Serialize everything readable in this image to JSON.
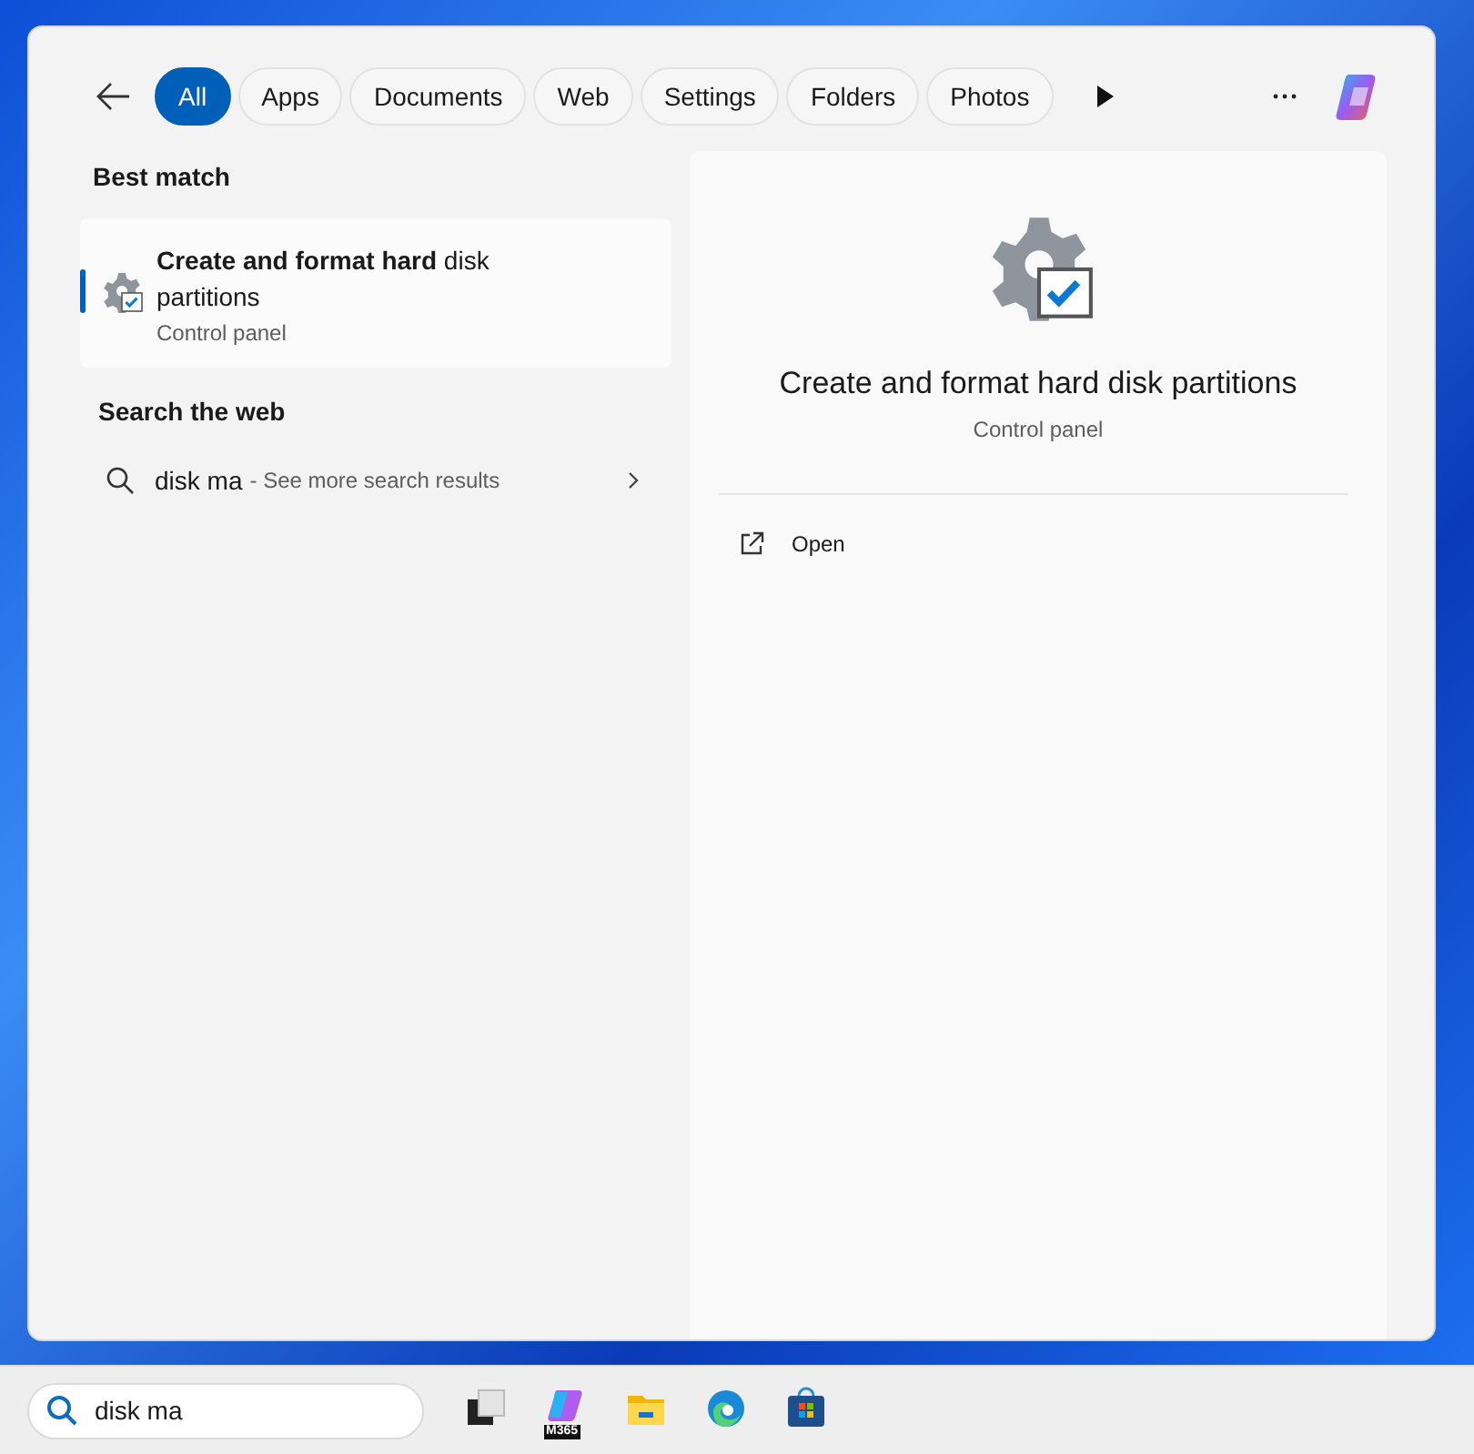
{
  "filter_tabs": [
    {
      "label": "All",
      "selected": true
    },
    {
      "label": "Apps",
      "selected": false
    },
    {
      "label": "Documents",
      "selected": false
    },
    {
      "label": "Web",
      "selected": false
    },
    {
      "label": "Settings",
      "selected": false
    },
    {
      "label": "Folders",
      "selected": false
    },
    {
      "label": "Photos",
      "selected": false
    }
  ],
  "best_match": {
    "heading": "Best match",
    "title": "**Create and format hard** disk partitions",
    "subtitle": "Control panel",
    "selected": true
  },
  "web_section": {
    "heading": "Search the web",
    "query": "disk ma",
    "hint": "- See more search results"
  },
  "preview": {
    "title": "Create and format hard disk partitions",
    "subtitle": "Control panel",
    "actions": [
      {
        "label": "Open"
      }
    ]
  },
  "taskbar": {
    "search": {
      "value": "disk ma"
    },
    "apps": [
      {
        "kind": "task-view"
      },
      {
        "kind": "m365",
        "badge": "M365"
      },
      {
        "kind": "folder"
      },
      {
        "kind": "edge"
      },
      {
        "kind": "store"
      }
    ]
  }
}
